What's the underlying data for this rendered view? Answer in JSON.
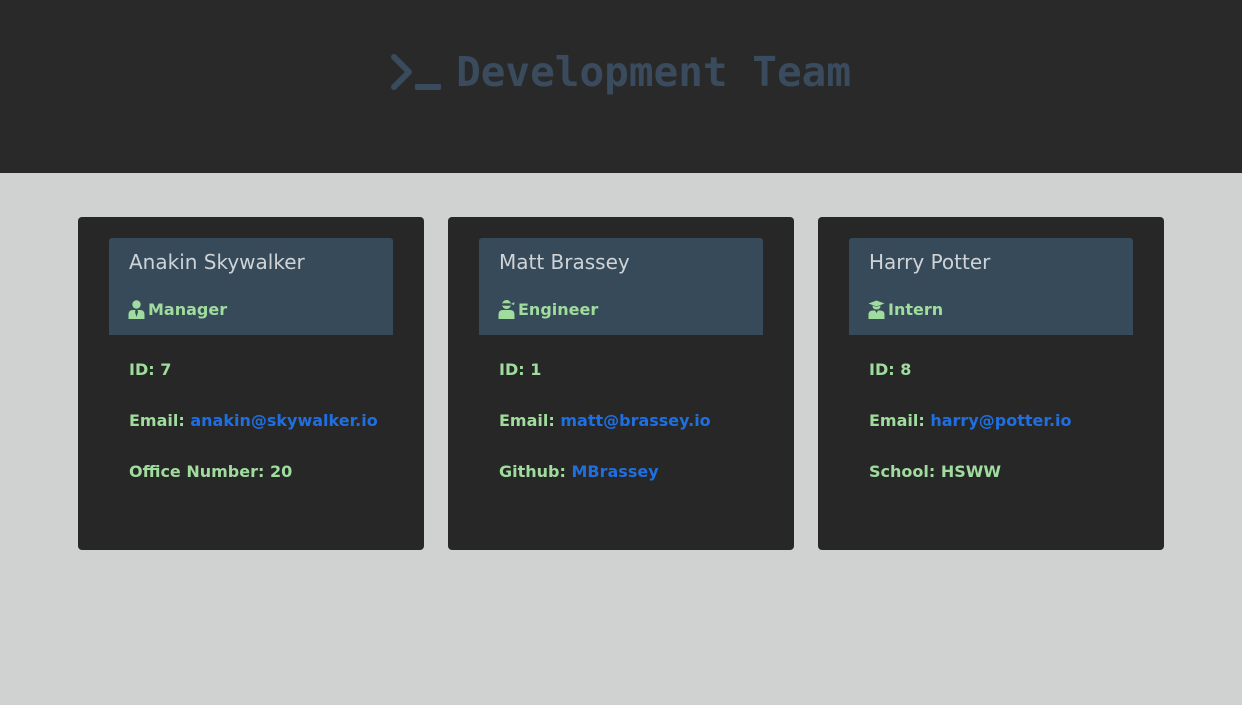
{
  "header": {
    "title": "Development Team",
    "icon": "terminal-prompt-icon"
  },
  "colors": {
    "header_bg": "#292929",
    "page_bg": "#d0d2d1",
    "card_bg": "#272727",
    "card_head_bg": "#374a59",
    "title": "#394b5c",
    "name": "#cfd3d6",
    "text_green": "#9fdc9d",
    "link_blue": "#1f6fe0"
  },
  "cards": [
    {
      "name": "Anakin Skywalker",
      "role": "Manager",
      "role_icon": "user-tie-icon",
      "id_label": "ID:",
      "id_value": "7",
      "email_label": "Email:",
      "email": "anakin@skywalker.io",
      "extra_label": "Office Number:",
      "extra_value": "20"
    },
    {
      "name": "Matt Brassey",
      "role": "Engineer",
      "role_icon": "user-ninja-icon",
      "id_label": "ID:",
      "id_value": "1",
      "email_label": "Email:",
      "email": "matt@brassey.io",
      "extra_label": "Github:",
      "extra_value": "MBrassey"
    },
    {
      "name": "Harry Potter",
      "role": "Intern",
      "role_icon": "user-graduate-icon",
      "id_label": "ID:",
      "id_value": "8",
      "email_label": "Email:",
      "email": "harry@potter.io",
      "extra_label": "School:",
      "extra_value": "HSWW"
    }
  ]
}
